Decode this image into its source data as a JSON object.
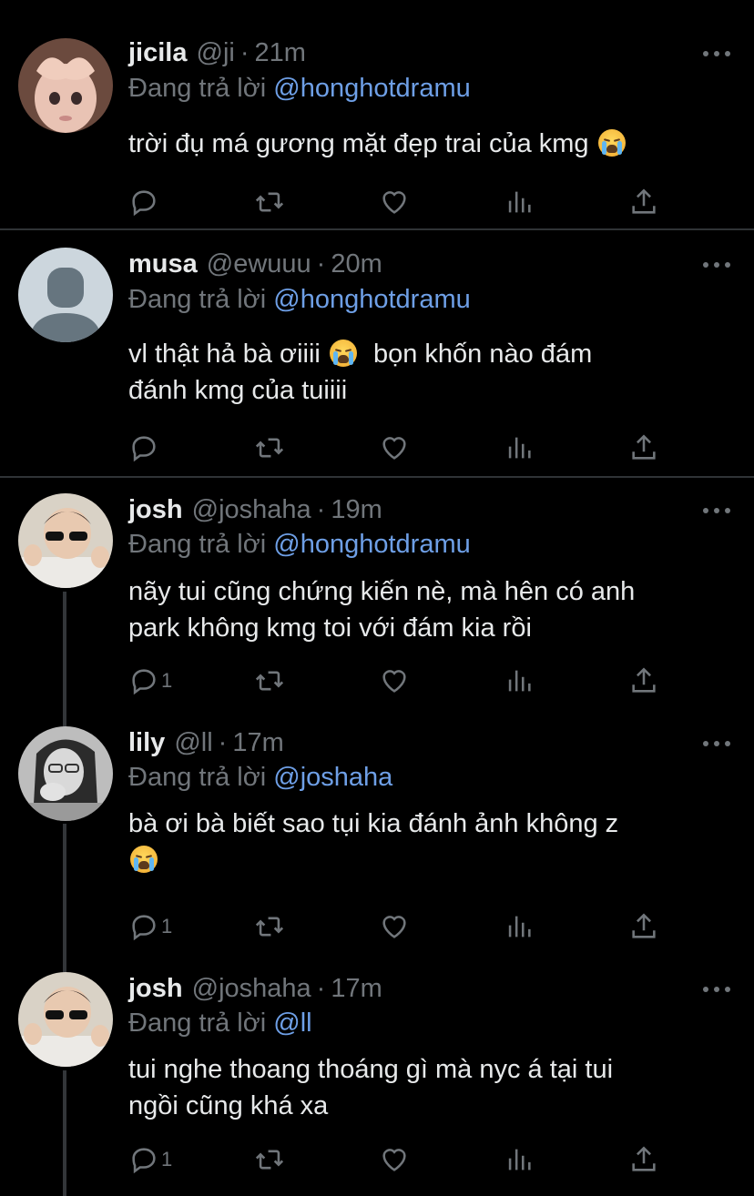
{
  "tweets": [
    {
      "name": "jicila",
      "handle": "@ji",
      "time": "21m",
      "reply_prefix": "Đang trả lời",
      "reply_mention": "@honghotdramu",
      "lines": [
        "trời đụ má gương mặt đẹp trai của kmg"
      ],
      "reply_count": ""
    },
    {
      "name": "musa",
      "handle": "@ewuuu",
      "time": "20m",
      "reply_prefix": "Đang trả lời",
      "reply_mention": "@honghotdramu",
      "lines": [
        "vl thật hả bà ơiiii",
        "bọn khốn nào đám",
        "đánh kmg của tuiiii"
      ],
      "reply_count": ""
    },
    {
      "name": "josh",
      "handle": "@joshaha",
      "time": "19m",
      "reply_prefix": "Đang trả lời",
      "reply_mention": "@honghotdramu",
      "lines": [
        "nãy tui cũng chứng kiến nè, mà hên có anh",
        "park không kmg toi với đám kia rồi"
      ],
      "reply_count": "1"
    },
    {
      "name": "lily",
      "handle": "@ll",
      "time": "17m",
      "reply_prefix": "Đang trả lời",
      "reply_mention": "@joshaha",
      "lines": [
        "bà ơi bà biết sao tụi kia đánh ảnh không z"
      ],
      "reply_count": "1"
    },
    {
      "name": "josh",
      "handle": "@joshaha",
      "time": "17m",
      "reply_prefix": "Đang trả lời",
      "reply_mention": "@ll",
      "lines": [
        "tui nghe thoang thoáng gì mà nyc á tại tui",
        "ngồi cũng khá xa"
      ],
      "reply_count": "1"
    }
  ],
  "separator": "·",
  "icons": [
    "reply-icon",
    "retweet-icon",
    "like-icon",
    "views-icon",
    "share-icon",
    "more-icon",
    "loudly-crying-face-emoji"
  ],
  "colors": {
    "background": "#000000",
    "text": "#e7e9ea",
    "muted": "#71767b",
    "mention": "#6e9fe6",
    "divider": "#2f3336"
  }
}
